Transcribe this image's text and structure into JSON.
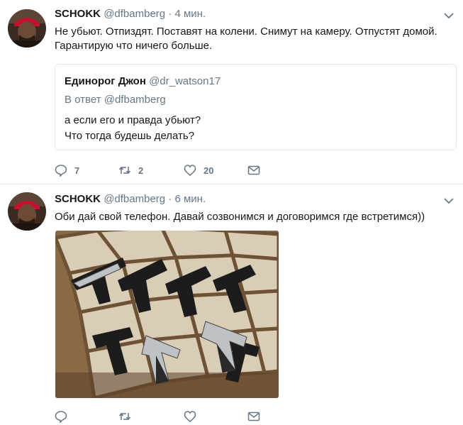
{
  "tweets": [
    {
      "name": "SCHOKK",
      "handle": "@dfbamberg",
      "time": "· 4 мин.",
      "text": "Не убьют. Отпиздят. Поставят на колени. Снимут на камеру. Отпустят домой. Гарантирую что ничего больше.",
      "quote": {
        "name": "Единорог Джон",
        "handle": "@dr_watson17",
        "reply_to": "В ответ @dfbamberg",
        "lines": [
          "а если его и правда убьют?",
          "Что тогда будешь делать?"
        ]
      },
      "actions": {
        "replies": "7",
        "retweets": "2",
        "likes": "20"
      }
    },
    {
      "name": "SCHOKK",
      "handle": "@dfbamberg",
      "time": "· 6 мин.",
      "text": "Оби дай свой телефон. Давай созвонимся и договоримся где встретимся))",
      "actions": {
        "replies": "",
        "retweets": "",
        "likes": ""
      }
    }
  ],
  "icons": {
    "reply": "reply-icon",
    "retweet": "retweet-icon",
    "like": "heart-icon",
    "dm": "envelope-icon",
    "caret": "chevron-down-icon"
  },
  "colors": {
    "text": "#14171a",
    "secondary": "#657786",
    "icon": "#657786",
    "border": "#e1e8ed"
  }
}
